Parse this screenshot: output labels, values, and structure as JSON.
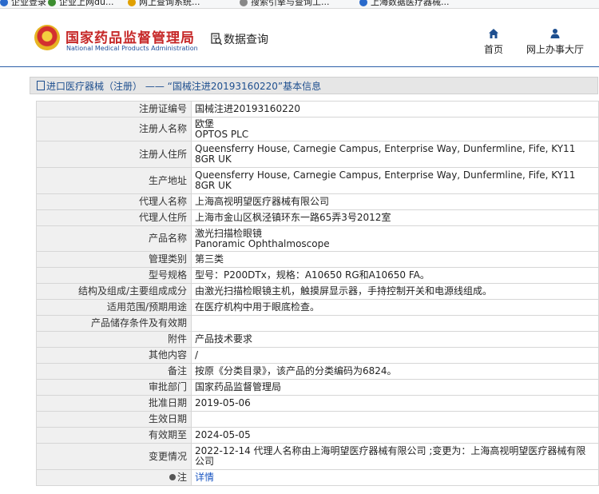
{
  "browser": {
    "bookmarks": [
      "企业登录",
      "企业上网du...",
      "网上查询系统...",
      "搜索引擎与查询工...",
      "上海数据医疗器械..."
    ]
  },
  "header": {
    "site_title": "国家药品监督管理局",
    "site_subtitle": "National Medical Products Administration",
    "data_query": "数据查询",
    "nav": {
      "home": "首页",
      "online_hall": "网上办事大厅"
    }
  },
  "breadcrumb": {
    "category": "进口医疗器械（注册）",
    "separator": " —— ",
    "record": "“国械注进20193160220”",
    "suffix": "基本信息"
  },
  "details": {
    "registration_number": {
      "label": "注册证编号",
      "value": "国械注进20193160220"
    },
    "registrant_name": {
      "label": "注册人名称",
      "value_line1": "欧堡",
      "value_line2": "OPTOS PLC"
    },
    "registrant_address": {
      "label": "注册人住所",
      "value": "Queensferry House, Carnegie Campus, Enterprise Way, Dunfermline, Fife, KY11 8GR UK"
    },
    "production_address": {
      "label": "生产地址",
      "value": "Queensferry House, Carnegie Campus, Enterprise Way, Dunfermline, Fife, KY11 8GR UK"
    },
    "agent_name": {
      "label": "代理人名称",
      "value": "上海高视明望医疗器械有限公司"
    },
    "agent_address": {
      "label": "代理人住所",
      "value": "上海市金山区枫泾镇环东一路65弄3号2012室"
    },
    "product_name": {
      "label": "产品名称",
      "value_line1": "激光扫描检眼镜",
      "value_line2": "Panoramic Ophthalmoscope"
    },
    "management_class": {
      "label": "管理类别",
      "value": "第三类"
    },
    "model_spec": {
      "label": "型号规格",
      "value": "型号：P200DTx，规格：A10650 RG和A10650 FA。"
    },
    "composition": {
      "label": "结构及组成/主要组成成分",
      "value": "由激光扫描检眼镜主机，触摸屏显示器，手持控制开关和电源线组成。"
    },
    "intended_use": {
      "label": "适用范围/预期用途",
      "value": "在医疗机构中用于眼底检查。"
    },
    "storage": {
      "label": "产品储存条件及有效期",
      "value": ""
    },
    "attachment": {
      "label": "附件",
      "value": "产品技术要求"
    },
    "other": {
      "label": "其他内容",
      "value": "/"
    },
    "remarks": {
      "label": "备注",
      "value": "按原《分类目录》，该产品的分类编码为6824。"
    },
    "approval_dept": {
      "label": "审批部门",
      "value": "国家药品监督管理局"
    },
    "approval_date": {
      "label": "批准日期",
      "value": "2019-05-06"
    },
    "effective_date": {
      "label": "生效日期",
      "value": ""
    },
    "valid_until": {
      "label": "有效期至",
      "value": "2024-05-05"
    },
    "change_status": {
      "label": "变更情况",
      "value": "2022-12-14 代理人名称由上海明望医疗器械有限公司 ;变更为：上海高视明望医疗器械有限公司"
    },
    "note": {
      "label": "注",
      "value": "详情"
    }
  }
}
